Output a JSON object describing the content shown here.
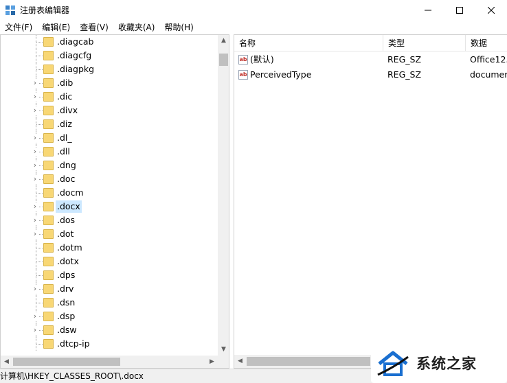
{
  "window": {
    "title": "注册表编辑器",
    "icon": "regedit-icon"
  },
  "menu": [
    "文件(F)",
    "编辑(E)",
    "查看(V)",
    "收藏夹(A)",
    "帮助(H)"
  ],
  "tree": {
    "items": [
      {
        "label": ".diagcab",
        "expandable": false
      },
      {
        "label": ".diagcfg",
        "expandable": false
      },
      {
        "label": ".diagpkg",
        "expandable": false
      },
      {
        "label": ".dib",
        "expandable": true
      },
      {
        "label": ".dic",
        "expandable": true
      },
      {
        "label": ".divx",
        "expandable": true
      },
      {
        "label": ".diz",
        "expandable": false
      },
      {
        "label": ".dl_",
        "expandable": true
      },
      {
        "label": ".dll",
        "expandable": true
      },
      {
        "label": ".dng",
        "expandable": true
      },
      {
        "label": ".doc",
        "expandable": true
      },
      {
        "label": ".docm",
        "expandable": false
      },
      {
        "label": ".docx",
        "expandable": true,
        "selected": true
      },
      {
        "label": ".dos",
        "expandable": true
      },
      {
        "label": ".dot",
        "expandable": true
      },
      {
        "label": ".dotm",
        "expandable": false
      },
      {
        "label": ".dotx",
        "expandable": false
      },
      {
        "label": ".dps",
        "expandable": false
      },
      {
        "label": ".drv",
        "expandable": true
      },
      {
        "label": ".dsn",
        "expandable": false
      },
      {
        "label": ".dsp",
        "expandable": true
      },
      {
        "label": ".dsw",
        "expandable": true
      },
      {
        "label": ".dtcp-ip",
        "expandable": false
      }
    ]
  },
  "list": {
    "columns": {
      "name": "名称",
      "type": "类型",
      "data": "数据"
    },
    "rows": [
      {
        "name": "(默认)",
        "type": "REG_SZ",
        "data": "Office12."
      },
      {
        "name": "PerceivedType",
        "type": "REG_SZ",
        "data": "documer"
      }
    ],
    "icon_text": "ab"
  },
  "status": {
    "path": "计算机\\HKEY_CLASSES_ROOT\\.docx"
  },
  "watermark": {
    "text": "系统之家"
  },
  "colors": {
    "selection": "#cce8ff",
    "folder": "#f8d775",
    "watermark_blue": "#1a6fd0"
  }
}
